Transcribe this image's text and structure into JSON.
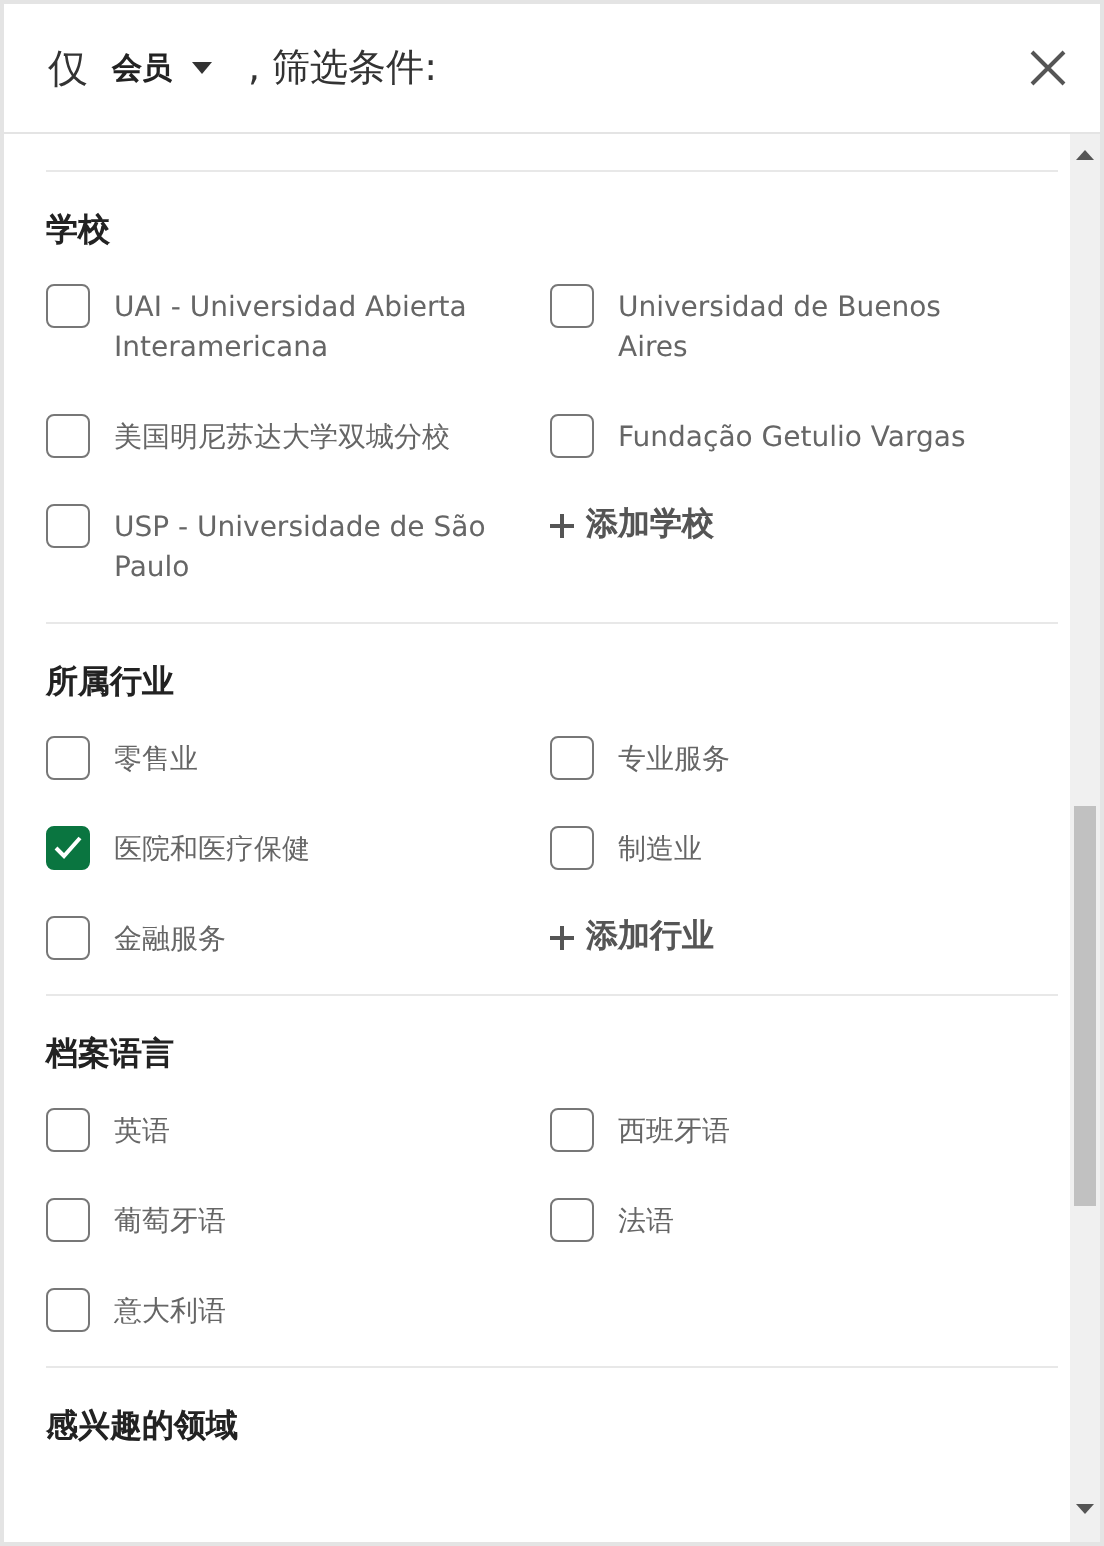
{
  "header": {
    "prefix": "仅",
    "dropdown": "会员",
    "suffix": ", 筛选条件:"
  },
  "sections": [
    {
      "title": "学校",
      "items": [
        {
          "kind": "checkbox",
          "label": "UAI - Universidad Abierta Interamericana",
          "checked": false
        },
        {
          "kind": "checkbox",
          "label": "Universidad de Buenos Aires",
          "checked": false
        },
        {
          "kind": "checkbox",
          "label": "美国明尼苏达大学双城分校",
          "checked": false
        },
        {
          "kind": "checkbox",
          "label": "Fundação Getulio Vargas",
          "checked": false
        },
        {
          "kind": "checkbox",
          "label": "USP - Universidade de São Paulo",
          "checked": false
        },
        {
          "kind": "add",
          "label": "添加学校"
        }
      ]
    },
    {
      "title": "所属行业",
      "items": [
        {
          "kind": "checkbox",
          "label": "零售业",
          "checked": false
        },
        {
          "kind": "checkbox",
          "label": "专业服务",
          "checked": false
        },
        {
          "kind": "checkbox",
          "label": "医院和医疗保健",
          "checked": true
        },
        {
          "kind": "checkbox",
          "label": "制造业",
          "checked": false
        },
        {
          "kind": "checkbox",
          "label": "金融服务",
          "checked": false
        },
        {
          "kind": "add",
          "label": "添加行业"
        }
      ]
    },
    {
      "title": "档案语言",
      "items": [
        {
          "kind": "checkbox",
          "label": "英语",
          "checked": false
        },
        {
          "kind": "checkbox",
          "label": "西班牙语",
          "checked": false
        },
        {
          "kind": "checkbox",
          "label": "葡萄牙语",
          "checked": false
        },
        {
          "kind": "checkbox",
          "label": "法语",
          "checked": false
        },
        {
          "kind": "checkbox",
          "label": "意大利语",
          "checked": false
        }
      ]
    },
    {
      "title": "感兴趣的领域"
    }
  ]
}
